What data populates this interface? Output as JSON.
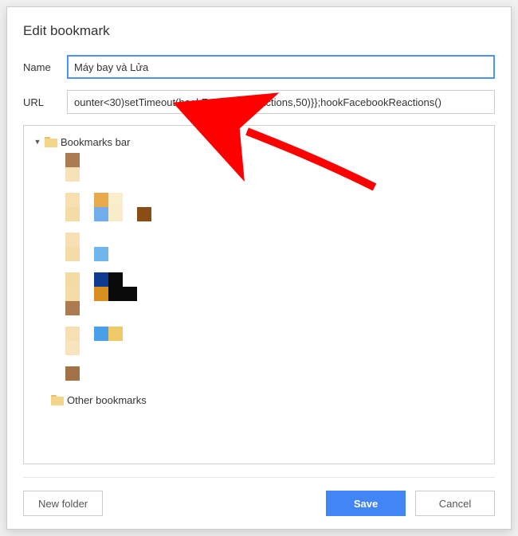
{
  "dialog": {
    "title": "Edit bookmark",
    "name_label": "Name",
    "name_value": "Máy bay và Lửa",
    "url_label": "URL",
    "url_value": "ounter<30)setTimeout(hookFacebookReactions,50)}};hookFacebookReactions()"
  },
  "tree": {
    "bookmarks_bar": "Bookmarks bar",
    "other_bookmarks": "Other bookmarks"
  },
  "buttons": {
    "new_folder": "New folder",
    "save": "Save",
    "cancel": "Cancel"
  },
  "pixel_blocks": [
    {
      "rows": [
        [
          null,
          "#ac7b50"
        ],
        [
          null,
          "#f6e2b8"
        ]
      ]
    },
    {
      "rows": [
        [
          null,
          "#f7e0b0",
          null,
          "#e8a94a",
          "#f8eecb",
          null,
          null
        ],
        [
          null,
          "#f5dba5",
          null,
          "#71aceb",
          "#f8eccb",
          null,
          "#894e16"
        ]
      ]
    },
    {
      "rows": [
        [
          null,
          "#f6e0b4",
          null,
          null,
          null
        ],
        [
          null,
          "#f5dba5",
          null,
          "#6fb6ef",
          null
        ]
      ]
    },
    {
      "rows": [
        [
          null,
          "#f3d9a2",
          null,
          "#0c3b8f",
          "#0a0a0a",
          null
        ],
        [
          null,
          "#f5dba5",
          null,
          "#d98e20",
          "#0a0a0a",
          "#0a0a0a"
        ],
        [
          null,
          "#ac7b50",
          null,
          null,
          null,
          null
        ]
      ]
    },
    {
      "rows": [
        [
          null,
          "#f6e0b3",
          null,
          "#4aa0e8",
          "#efc965"
        ],
        [
          null,
          "#f7e4bc",
          null,
          null,
          null
        ]
      ]
    },
    {
      "rows": [
        [
          null,
          "#a27247"
        ]
      ]
    }
  ]
}
